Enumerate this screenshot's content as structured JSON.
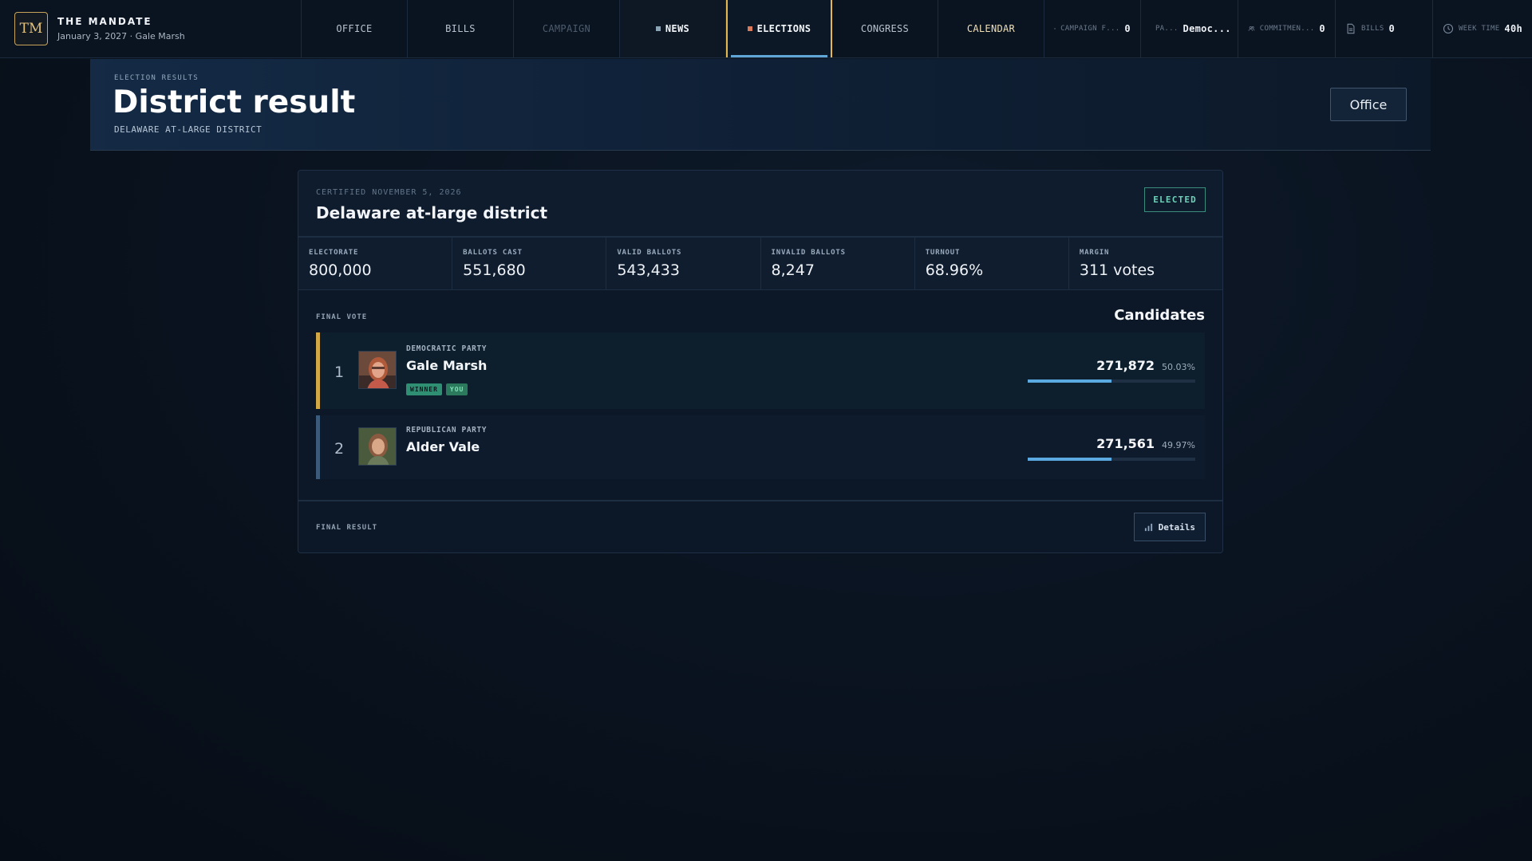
{
  "brand": {
    "logo": "TM",
    "title": "THE MANDATE",
    "subtitle": "January 3, 2027 · Gale Marsh"
  },
  "nav": [
    {
      "label": "OFFICE",
      "state": "normal"
    },
    {
      "label": "BILLS",
      "state": "normal"
    },
    {
      "label": "CAMPAIGN",
      "state": "disabled"
    },
    {
      "label": "NEWS",
      "state": "bright"
    },
    {
      "label": "ELECTIONS",
      "state": "active"
    },
    {
      "label": "CONGRESS",
      "state": "normal"
    },
    {
      "label": "CALENDAR",
      "state": "highlight"
    }
  ],
  "stats": {
    "campaign_funds": {
      "label": "CAMPAIGN F...",
      "value": "0",
      "icon": "money-icon"
    },
    "party": {
      "label": "PA...",
      "value": "Democ...",
      "icon": "star-icon"
    },
    "commitments": {
      "label": "COMMITMEN...",
      "value": "0",
      "icon": "people-icon"
    },
    "bills": {
      "label": "BILLS",
      "value": "0",
      "icon": "document-icon"
    },
    "week_time": {
      "label": "WEEK TIME",
      "value": "40h",
      "icon": "clock-icon"
    }
  },
  "header": {
    "eyebrow": "ELECTION RESULTS",
    "title": "District result",
    "subtitle": "DELAWARE AT-LARGE DISTRICT",
    "office_button": "Office"
  },
  "card": {
    "certified": "CERTIFIED NOVEMBER 5, 2026",
    "district": "Delaware at-large district",
    "status_badge": "ELECTED",
    "metrics": [
      {
        "label": "ELECTORATE",
        "value": "800,000"
      },
      {
        "label": "BALLOTS CAST",
        "value": "551,680"
      },
      {
        "label": "VALID BALLOTS",
        "value": "543,433"
      },
      {
        "label": "INVALID BALLOTS",
        "value": "8,247"
      },
      {
        "label": "TURNOUT",
        "value": "68.96%"
      },
      {
        "label": "MARGIN",
        "value": "311 votes"
      }
    ],
    "final_vote_label": "FINAL VOTE",
    "candidates_title": "Candidates",
    "candidates": [
      {
        "rank": "1",
        "party": "DEMOCRATIC PARTY",
        "name": "Gale Marsh",
        "votes": "271,872",
        "percent": "50.03%",
        "share": 0.5003,
        "tags": [
          "WINNER",
          "YOU"
        ]
      },
      {
        "rank": "2",
        "party": "REPUBLICAN PARTY",
        "name": "Alder Vale",
        "votes": "271,561",
        "percent": "49.97%",
        "share": 0.4997,
        "tags": []
      }
    ],
    "final_result_label": "FINAL RESULT",
    "details_button": "Details"
  },
  "colors": {
    "accent_gold": "#d2a745",
    "accent_blue": "#5aa9e0",
    "elected_green": "#6fd1b8"
  }
}
